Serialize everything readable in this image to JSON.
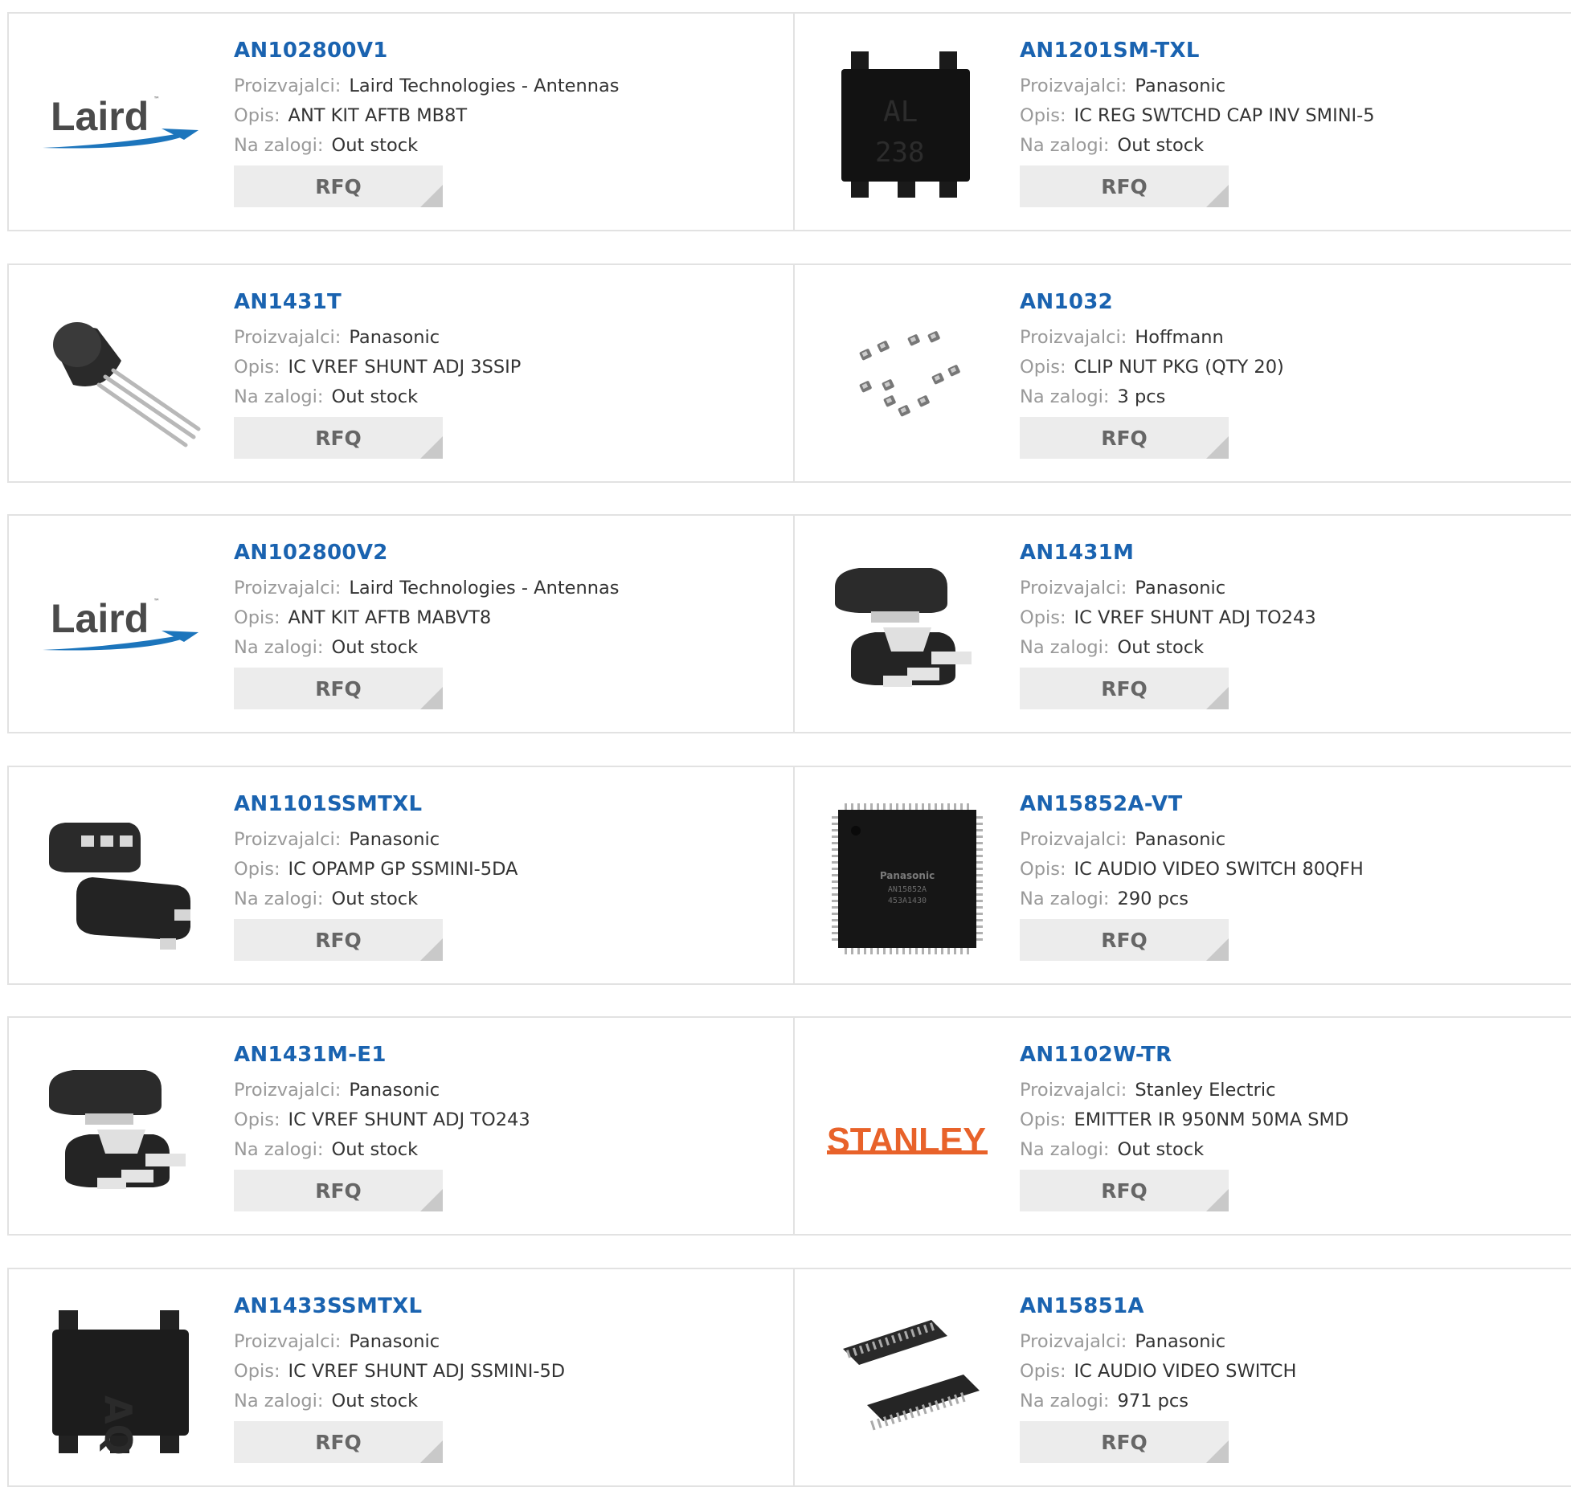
{
  "labels": {
    "manufacturer": "Proizvajalci:",
    "description": "Opis:",
    "stock": "Na zalogi:",
    "rfq": "RFQ"
  },
  "colors": {
    "part_link": "#1a63b0",
    "label": "#999999",
    "border": "#e2e2e2",
    "rfq_bg": "#ececec",
    "laird_blue": "#1c75bc",
    "stanley_orange": "#e8622a"
  },
  "rows": [
    [
      {
        "part": "AN102800V1",
        "manufacturer": "Laird Technologies - Antennas",
        "description": "ANT KIT AFTB MB8T",
        "stock": "Out stock",
        "image": "laird-logo"
      },
      {
        "part": "AN1201SM-TXL",
        "manufacturer": "Panasonic",
        "description": "IC REG SWTCHD CAP INV SMINI-5",
        "stock": "Out stock",
        "image": "chip-smini5",
        "marking": "AL 238"
      }
    ],
    [
      {
        "part": "AN1431T",
        "manufacturer": "Panasonic",
        "description": "IC VREF SHUNT ADJ 3SSIP",
        "stock": "Out stock",
        "image": "to92-transistor"
      },
      {
        "part": "AN1032",
        "manufacturer": "Hoffmann",
        "description": "CLIP NUT PKG (QTY 20)",
        "stock": "3 pcs",
        "image": "clip-nuts"
      }
    ],
    [
      {
        "part": "AN102800V2",
        "manufacturer": "Laird Technologies - Antennas",
        "description": "ANT KIT AFTB MABVT8",
        "stock": "Out stock",
        "image": "laird-logo"
      },
      {
        "part": "AN1431M",
        "manufacturer": "Panasonic",
        "description": "IC VREF SHUNT ADJ TO243",
        "stock": "Out stock",
        "image": "sot89-package"
      }
    ],
    [
      {
        "part": "AN1101SSMTXL",
        "manufacturer": "Panasonic",
        "description": "IC OPAMP GP SSMINI-5DA",
        "stock": "Out stock",
        "image": "ssmini5-package"
      },
      {
        "part": "AN15852A-VT",
        "manufacturer": "Panasonic",
        "description": "IC AUDIO VIDEO SWITCH 80QFH",
        "stock": "290 pcs",
        "image": "qfp-chip",
        "marking": "Panasonic AN15852A 453A1430"
      }
    ],
    [
      {
        "part": "AN1431M-E1",
        "manufacturer": "Panasonic",
        "description": "IC VREF SHUNT ADJ TO243",
        "stock": "Out stock",
        "image": "sot89-package"
      },
      {
        "part": "AN1102W-TR",
        "manufacturer": "Stanley Electric",
        "description": "EMITTER IR 950NM 50MA SMD",
        "stock": "Out stock",
        "image": "stanley-logo"
      }
    ],
    [
      {
        "part": "AN1433SSMTXL",
        "manufacturer": "Panasonic",
        "description": "IC VREF SHUNT ADJ SSMINI-5D",
        "stock": "Out stock",
        "image": "chip-ssmini5d"
      },
      {
        "part": "AN15851A",
        "manufacturer": "Panasonic",
        "description": "IC AUDIO VIDEO SWITCH",
        "stock": "971 pcs",
        "image": "ssop-package"
      }
    ]
  ],
  "logos": {
    "laird": "Laird",
    "stanley": "STANLEY"
  }
}
